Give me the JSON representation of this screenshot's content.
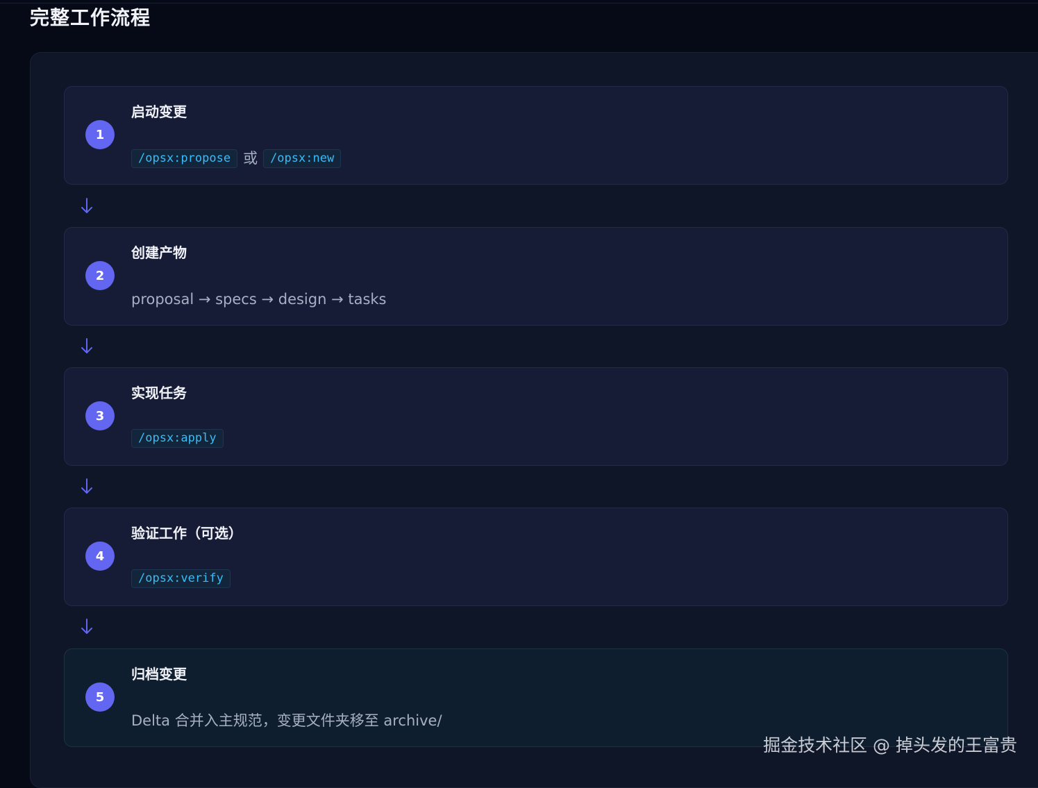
{
  "page": {
    "title": "完整工作流程"
  },
  "steps": [
    {
      "number": "1",
      "title": "启动变更",
      "commands": [
        "/opsx:propose",
        "/opsx:new"
      ],
      "connector": "或"
    },
    {
      "number": "2",
      "title": "创建产物",
      "text": "proposal → specs → design → tasks"
    },
    {
      "number": "3",
      "title": "实现任务",
      "commands": [
        "/opsx:apply"
      ]
    },
    {
      "number": "4",
      "title": "验证工作（可选）",
      "commands": [
        "/opsx:verify"
      ]
    },
    {
      "number": "5",
      "title": "归档变更",
      "text": "Delta 合并入主规范，变更文件夹移至 archive/"
    }
  ],
  "icons": {
    "flow_arrow": "arrow-down-icon"
  },
  "colors": {
    "accent": "#6366f1",
    "code": "#38bdf8",
    "background": "#060a17",
    "panel": "#0f1628",
    "card": "#161c36"
  },
  "watermark": {
    "text": "掘金技术社区 @ 掉头发的王富贵"
  }
}
